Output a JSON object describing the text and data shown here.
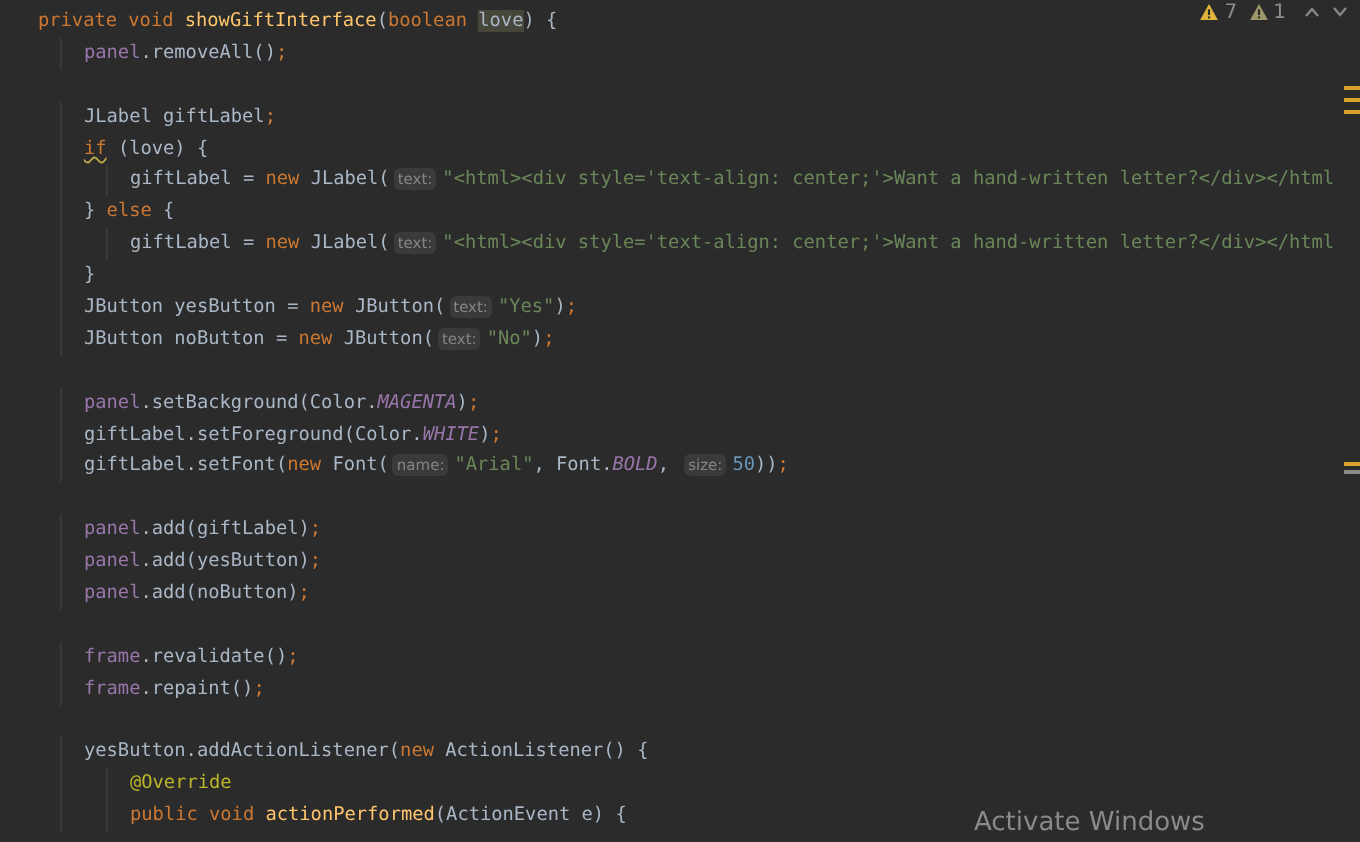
{
  "editor": {
    "inspections": [
      {
        "kind": "warning",
        "count": "7"
      },
      {
        "kind": "weak_warning",
        "count": "1"
      }
    ],
    "lines": [
      {
        "tokens": [
          {
            "kind": "kw",
            "t": "private void "
          },
          {
            "kind": "decl",
            "t": "showGiftInterface"
          },
          {
            "kind": "plain",
            "t": "("
          },
          {
            "kind": "kw",
            "t": "boolean "
          },
          {
            "kind": "hl",
            "t": "love"
          },
          {
            "kind": "plain",
            "t": ") {"
          }
        ],
        "children": [
          {
            "tokens": [
              {
                "kind": "field",
                "t": "panel"
              },
              {
                "kind": "plain",
                "t": ".removeAll()"
              },
              {
                "kind": "kw",
                "t": ";"
              }
            ]
          },
          {
            "gap_before": true,
            "tokens": [
              {
                "kind": "plain",
                "t": "JLabel giftLabel"
              },
              {
                "kind": "kw",
                "t": ";"
              }
            ]
          },
          {
            "tokens": [
              {
                "kind": "warn",
                "t": "if"
              },
              {
                "kind": "plain",
                "t": " (love) {"
              }
            ],
            "children": [
              {
                "tokens": [
                  {
                    "kind": "plain",
                    "t": "giftLabel = "
                  },
                  {
                    "kind": "kw",
                    "t": "new "
                  },
                  {
                    "kind": "plain",
                    "t": "JLabel("
                  },
                  {
                    "kind": "hint",
                    "t": "text:"
                  },
                  {
                    "kind": "str",
                    "t": "\"<html><div style='text-align: center;'>Want a hand-written letter?</div></html"
                  }
                ]
              }
            ]
          },
          {
            "tokens": [
              {
                "kind": "plain",
                "t": "} "
              },
              {
                "kind": "kw",
                "t": "else "
              },
              {
                "kind": "plain",
                "t": "{"
              }
            ],
            "children": [
              {
                "tokens": [
                  {
                    "kind": "plain",
                    "t": "giftLabel = "
                  },
                  {
                    "kind": "kw",
                    "t": "new "
                  },
                  {
                    "kind": "plain",
                    "t": "JLabel("
                  },
                  {
                    "kind": "hint",
                    "t": "text:"
                  },
                  {
                    "kind": "str",
                    "t": "\"<html><div style='text-align: center;'>Want a hand-written letter?</div></html"
                  }
                ]
              }
            ]
          },
          {
            "tokens": [
              {
                "kind": "plain",
                "t": "}"
              }
            ]
          },
          {
            "tokens": [
              {
                "kind": "plain",
                "t": "JButton yesButton = "
              },
              {
                "kind": "kw",
                "t": "new "
              },
              {
                "kind": "plain",
                "t": "JButton("
              },
              {
                "kind": "hint",
                "t": "text:"
              },
              {
                "kind": "str",
                "t": "\"Yes\""
              },
              {
                "kind": "plain",
                "t": ")"
              },
              {
                "kind": "kw",
                "t": ";"
              }
            ]
          },
          {
            "tokens": [
              {
                "kind": "plain",
                "t": "JButton noButton = "
              },
              {
                "kind": "kw",
                "t": "new "
              },
              {
                "kind": "plain",
                "t": "JButton("
              },
              {
                "kind": "hint",
                "t": "text:"
              },
              {
                "kind": "str",
                "t": "\"No\""
              },
              {
                "kind": "plain",
                "t": ")"
              },
              {
                "kind": "kw",
                "t": ";"
              }
            ]
          },
          {
            "gap_before": true,
            "tokens": [
              {
                "kind": "field",
                "t": "panel"
              },
              {
                "kind": "plain",
                "t": ".setBackground(Color."
              },
              {
                "kind": "const",
                "t": "MAGENTA"
              },
              {
                "kind": "plain",
                "t": ")"
              },
              {
                "kind": "kw",
                "t": ";"
              }
            ]
          },
          {
            "tokens": [
              {
                "kind": "plain",
                "t": "giftLabel.setForeground(Color."
              },
              {
                "kind": "const",
                "t": "WHITE"
              },
              {
                "kind": "plain",
                "t": ")"
              },
              {
                "kind": "kw",
                "t": ";"
              }
            ]
          },
          {
            "tokens": [
              {
                "kind": "plain",
                "t": "giftLabel.setFont("
              },
              {
                "kind": "kw",
                "t": "new "
              },
              {
                "kind": "plain",
                "t": "Font("
              },
              {
                "kind": "hint",
                "t": "name:"
              },
              {
                "kind": "str",
                "t": "\"Arial\""
              },
              {
                "kind": "plain",
                "t": ", Font."
              },
              {
                "kind": "const",
                "t": "BOLD"
              },
              {
                "kind": "plain",
                "t": ", "
              },
              {
                "kind": "hint",
                "t": "size:"
              },
              {
                "kind": "num",
                "t": "50"
              },
              {
                "kind": "plain",
                "t": "))"
              },
              {
                "kind": "kw",
                "t": ";"
              }
            ]
          },
          {
            "gap_before": true,
            "tokens": [
              {
                "kind": "field",
                "t": "panel"
              },
              {
                "kind": "plain",
                "t": ".add(giftLabel)"
              },
              {
                "kind": "kw",
                "t": ";"
              }
            ]
          },
          {
            "tokens": [
              {
                "kind": "field",
                "t": "panel"
              },
              {
                "kind": "plain",
                "t": ".add(yesButton)"
              },
              {
                "kind": "kw",
                "t": ";"
              }
            ]
          },
          {
            "tokens": [
              {
                "kind": "field",
                "t": "panel"
              },
              {
                "kind": "plain",
                "t": ".add(noButton)"
              },
              {
                "kind": "kw",
                "t": ";"
              }
            ]
          },
          {
            "gap_before": true,
            "tokens": [
              {
                "kind": "field",
                "t": "frame"
              },
              {
                "kind": "plain",
                "t": ".revalidate()"
              },
              {
                "kind": "kw",
                "t": ";"
              }
            ]
          },
          {
            "tokens": [
              {
                "kind": "field",
                "t": "frame"
              },
              {
                "kind": "plain",
                "t": ".repaint()"
              },
              {
                "kind": "kw",
                "t": ";"
              }
            ]
          },
          {
            "gap_before": true,
            "tokens": [
              {
                "kind": "plain",
                "t": "yesButton.addActionListener("
              },
              {
                "kind": "kw",
                "t": "new "
              },
              {
                "kind": "plain",
                "t": "ActionListener() {"
              }
            ],
            "children": [
              {
                "tokens": [
                  {
                    "kind": "ann",
                    "t": "@Override"
                  }
                ]
              },
              {
                "tokens": [
                  {
                    "kind": "kw",
                    "t": "public void "
                  },
                  {
                    "kind": "decl",
                    "t": "actionPerformed"
                  },
                  {
                    "kind": "plain",
                    "t": "(ActionEvent e) {"
                  }
                ]
              }
            ]
          }
        ]
      }
    ]
  },
  "os_overlay": {
    "text": "Activate Windows"
  }
}
